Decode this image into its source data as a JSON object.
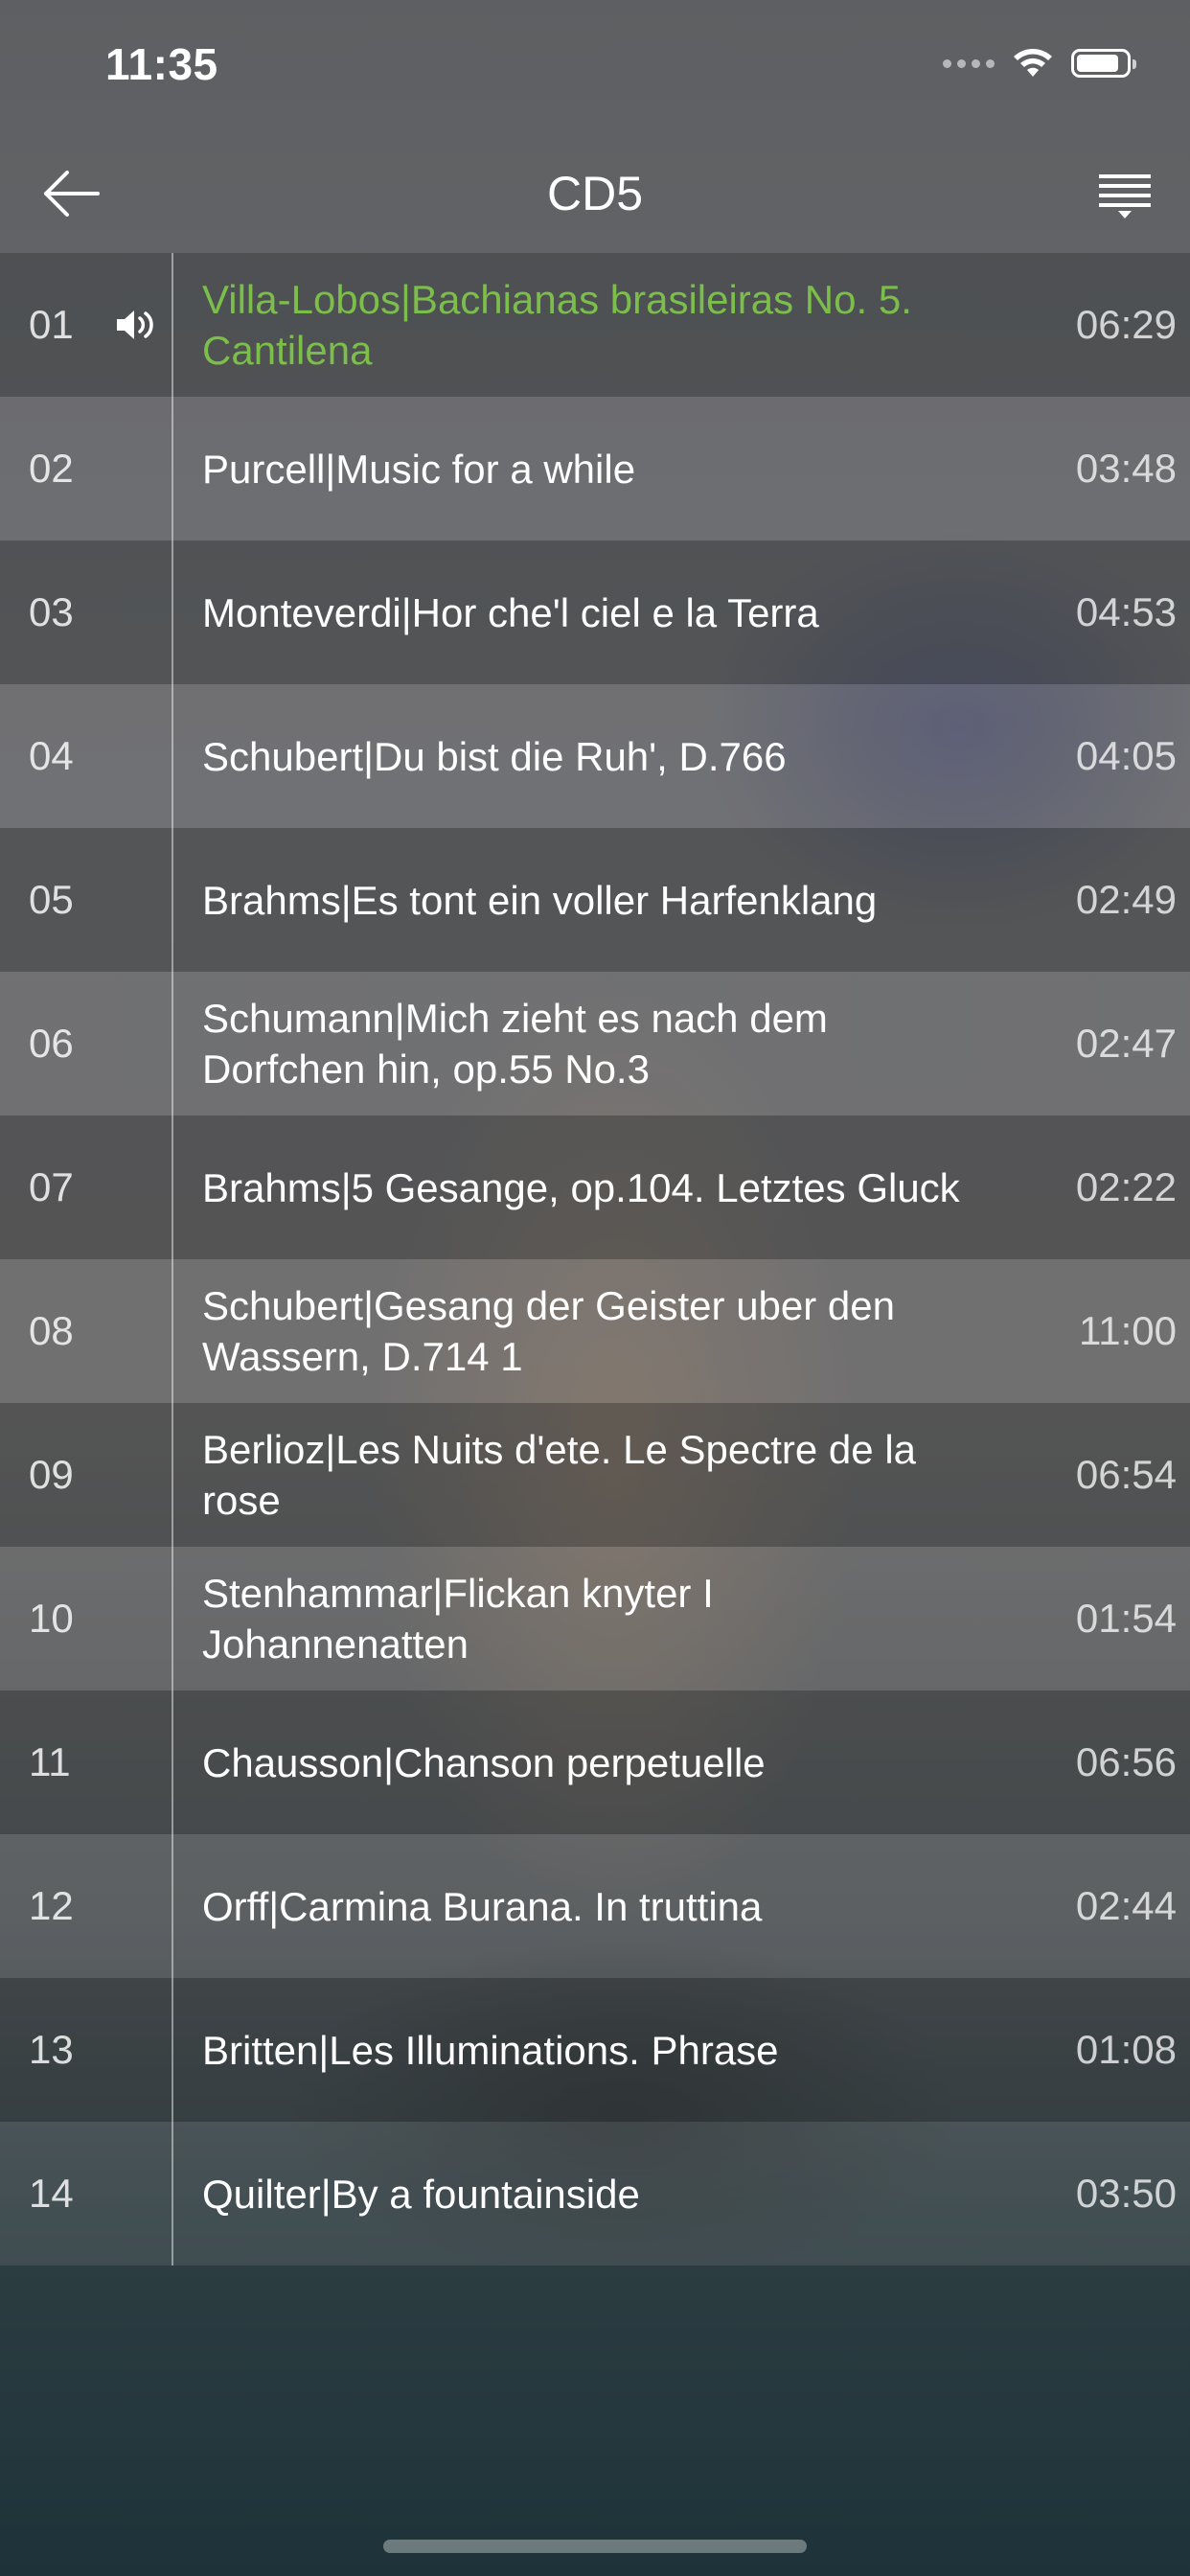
{
  "status_bar": {
    "time": "11:35"
  },
  "nav": {
    "title": "CD5"
  },
  "playing_color": "#7cbe4a",
  "tracks": [
    {
      "number": "01",
      "title": "Villa-Lobos|Bachianas brasileiras No. 5. Cantilena",
      "duration": "06:29",
      "playing": true
    },
    {
      "number": "02",
      "title": "Purcell|Music for a while",
      "duration": "03:48"
    },
    {
      "number": "03",
      "title": "Monteverdi|Hor che'l ciel e la Terra",
      "duration": "04:53"
    },
    {
      "number": "04",
      "title": "Schubert|Du bist die Ruh', D.766",
      "duration": "04:05"
    },
    {
      "number": "05",
      "title": "Brahms|Es tont ein voller Harfenklang",
      "duration": "02:49"
    },
    {
      "number": "06",
      "title": "Schumann|Mich zieht es nach dem Dorfchen hin, op.55 No.3",
      "duration": "02:47"
    },
    {
      "number": "07",
      "title": "Brahms|5 Gesange, op.104. Letztes Gluck",
      "duration": "02:22"
    },
    {
      "number": "08",
      "title": "Schubert|Gesang der Geister uber den Wassern, D.714 1",
      "duration": "11:00"
    },
    {
      "number": "09",
      "title": "Berlioz|Les Nuits d'ete. Le Spectre de la rose",
      "duration": "06:54"
    },
    {
      "number": "10",
      "title": "Stenhammar|Flickan knyter I Johannenatten",
      "duration": "01:54"
    },
    {
      "number": "11",
      "title": "Chausson|Chanson perpetuelle",
      "duration": "06:56"
    },
    {
      "number": "12",
      "title": "Orff|Carmina Burana. In truttina",
      "duration": "02:44"
    },
    {
      "number": "13",
      "title": "Britten|Les Illuminations. Phrase",
      "duration": "01:08"
    },
    {
      "number": "14",
      "title": "Quilter|By a fountainside",
      "duration": "03:50"
    }
  ]
}
